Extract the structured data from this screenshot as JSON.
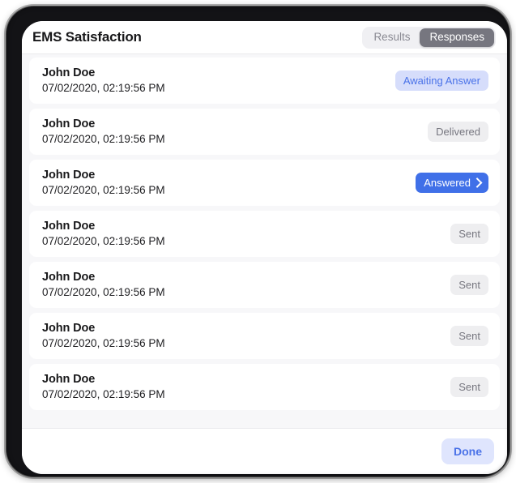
{
  "window": {
    "frame_color": "#131316",
    "card_background": "#ffffff",
    "list_background": "#f7f7f9"
  },
  "header": {
    "title": "EMS Satisfaction",
    "segmented_control": {
      "selected": "Responses",
      "options": [
        {
          "label": "Results",
          "active": false
        },
        {
          "label": "Responses",
          "active": true
        }
      ],
      "track_color": "#f0f0f3",
      "active_color": "#76767f"
    }
  },
  "list": {
    "rows": [
      {
        "name": "John Doe",
        "date": "07/02/2020, 02:19:56 PM",
        "status": {
          "label": "Awaiting Answer",
          "variant": "awaiting",
          "chevron": false
        }
      },
      {
        "name": "John Doe",
        "date": "07/02/2020, 02:19:56 PM",
        "status": {
          "label": "Delivered",
          "variant": "delivered",
          "chevron": false
        }
      },
      {
        "name": "John Doe",
        "date": "07/02/2020, 02:19:56 PM",
        "status": {
          "label": "Answered",
          "variant": "answered",
          "chevron": true
        }
      },
      {
        "name": "John Doe",
        "date": "07/02/2020, 02:19:56 PM",
        "status": {
          "label": "Sent",
          "variant": "sent",
          "chevron": false
        }
      },
      {
        "name": "John Doe",
        "date": "07/02/2020, 02:19:56 PM",
        "status": {
          "label": "Sent",
          "variant": "sent",
          "chevron": false
        }
      },
      {
        "name": "John Doe",
        "date": "07/02/2020, 02:19:56 PM",
        "status": {
          "label": "Sent",
          "variant": "sent",
          "chevron": false
        }
      },
      {
        "name": "John Doe",
        "date": "07/02/2020, 02:19:56 PM",
        "status": {
          "label": "Sent",
          "variant": "sent",
          "chevron": false
        }
      }
    ]
  },
  "footer": {
    "done_label": "Done",
    "done_background": "#dfe5fd",
    "done_text_color": "#4a72e8"
  },
  "colors": {
    "accent_blue": "#4070e8",
    "accent_blue_soft": "#d6ddfb",
    "neutral_badge": "#eeeef0",
    "neutral_text": "#76767f"
  }
}
